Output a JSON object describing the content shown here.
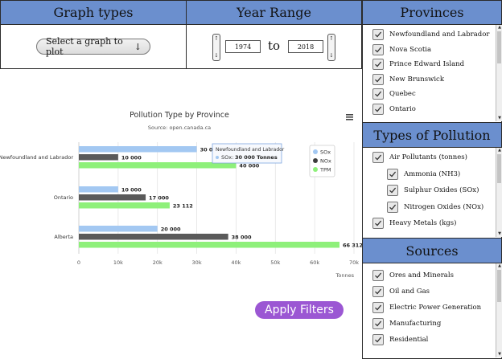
{
  "graph_types": {
    "title": "Graph types",
    "select_label": "Select a graph to plot",
    "select_arrow": "↓"
  },
  "year_range": {
    "title": "Year Range",
    "start": "1974",
    "end": "2018",
    "to_label": "to"
  },
  "provinces": {
    "title": "Provinces",
    "items": [
      {
        "label": "Newfoundland and Labrador",
        "checked": true
      },
      {
        "label": "Nova Scotia",
        "checked": true
      },
      {
        "label": "Prince Edward Island",
        "checked": true
      },
      {
        "label": "New Brunswick",
        "checked": true
      },
      {
        "label": "Quebec",
        "checked": true
      },
      {
        "label": "Ontario",
        "checked": true
      }
    ]
  },
  "pollution": {
    "title": "Types of Pollution",
    "items": [
      {
        "label": "Air Pollutants (tonnes)",
        "checked": true,
        "level": 0
      },
      {
        "label": "Ammonia (NH3)",
        "checked": true,
        "level": 1
      },
      {
        "label": "Sulphur Oxides (SOx)",
        "checked": true,
        "level": 1
      },
      {
        "label": "Nitrogen Oxides (NOx)",
        "checked": true,
        "level": 1
      },
      {
        "label": "Heavy Metals (kgs)",
        "checked": true,
        "level": 0
      }
    ]
  },
  "sources": {
    "title": "Sources",
    "items": [
      {
        "label": "Ores and Minerals",
        "checked": true
      },
      {
        "label": "Oil and Gas",
        "checked": true
      },
      {
        "label": "Electric Power Generation",
        "checked": true
      },
      {
        "label": "Manufacturing",
        "checked": true
      },
      {
        "label": "Residential",
        "checked": true
      }
    ]
  },
  "menu_icon": "hamburger-menu-icon",
  "apply_button": {
    "label": "Apply Filters",
    "color": "#9b57d3"
  },
  "colors": {
    "header": "#6b8fce",
    "sox": "#a3c8f2",
    "nox": "#5a5a5a",
    "tpm": "#8ef07a"
  },
  "tooltip": {
    "title": "Newfoundland and Labrador",
    "series": "SOx:",
    "value": "30 000 Tonnes"
  },
  "chart_data": {
    "type": "bar",
    "orientation": "horizontal",
    "title": "Pollution Type by Province",
    "subtitle": "Source: open.canada.ca",
    "categories": [
      "Newfoundland and Labrador",
      "Ontario",
      "Alberta"
    ],
    "series": [
      {
        "name": "SOx",
        "color": "#a3c8f2",
        "values": [
          30000,
          10000,
          20000
        ],
        "labels": [
          "30 000",
          "10 000",
          "20 000"
        ]
      },
      {
        "name": "NOx",
        "color": "#5a5a5a",
        "values": [
          10000,
          17000,
          38000
        ],
        "labels": [
          "10 000",
          "17 000",
          "38 000"
        ]
      },
      {
        "name": "TPM",
        "color": "#8ef07a",
        "values": [
          40000,
          23112,
          66312
        ],
        "labels": [
          "40 000",
          "23 112",
          "66 312"
        ]
      }
    ],
    "xlabel": "Tonnes",
    "xlim": [
      0,
      70000
    ],
    "ticks": [
      0,
      10000,
      20000,
      30000,
      40000,
      50000,
      60000,
      70000
    ],
    "tick_labels": [
      "0",
      "10k",
      "20k",
      "30k",
      "40k",
      "50k",
      "60k",
      "70k"
    ],
    "grid": true,
    "legend": "top-right"
  }
}
